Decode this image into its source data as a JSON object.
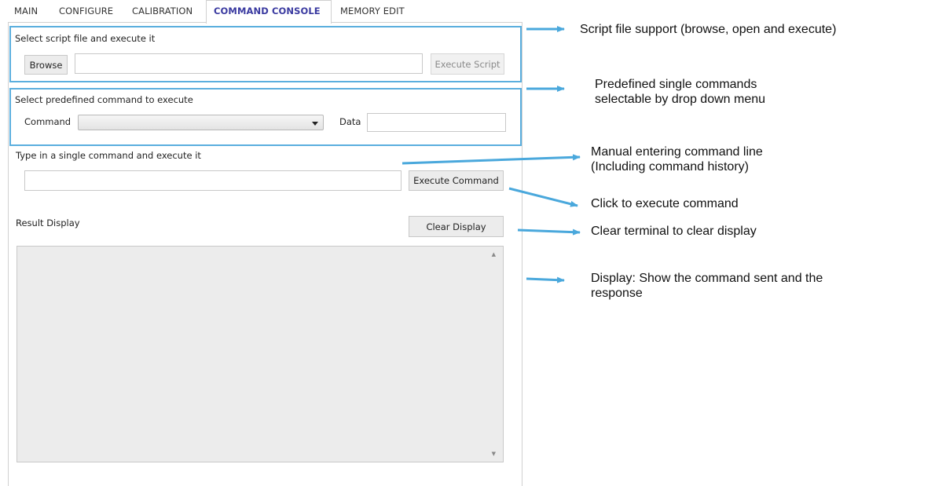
{
  "tabs": [
    "MAIN",
    "CONFIGURE",
    "CALIBRATION",
    "COMMAND CONSOLE",
    "MEMORY EDIT"
  ],
  "active_tab": "COMMAND CONSOLE",
  "script_section": {
    "label": "Select script file and execute it",
    "browse_label": "Browse",
    "path_value": "",
    "execute_label": "Execute Script"
  },
  "predefined_section": {
    "label": "Select predefined command to execute",
    "command_label": "Command",
    "command_selected": "",
    "data_label": "Data",
    "data_value": ""
  },
  "manual_section": {
    "label": "Type in a single command and execute it",
    "command_value": "",
    "execute_label": "Execute Command"
  },
  "result_section": {
    "label": "Result Display",
    "clear_label": "Clear Display",
    "content": ""
  },
  "annotations": {
    "script": "Script file support (browse, open and execute)",
    "predefined_line1": "Predefined single commands",
    "predefined_line2": "selectable by drop down menu",
    "manual_line1": "Manual entering command line",
    "manual_line2": "(Including command history)",
    "click": "Click to execute command",
    "clear": "Clear terminal to clear display",
    "display_line1": "Display: Show the command sent and the",
    "display_line2": "response"
  },
  "colors": {
    "accent": "#5aaede",
    "active_tab_text": "#3a3aa0"
  }
}
